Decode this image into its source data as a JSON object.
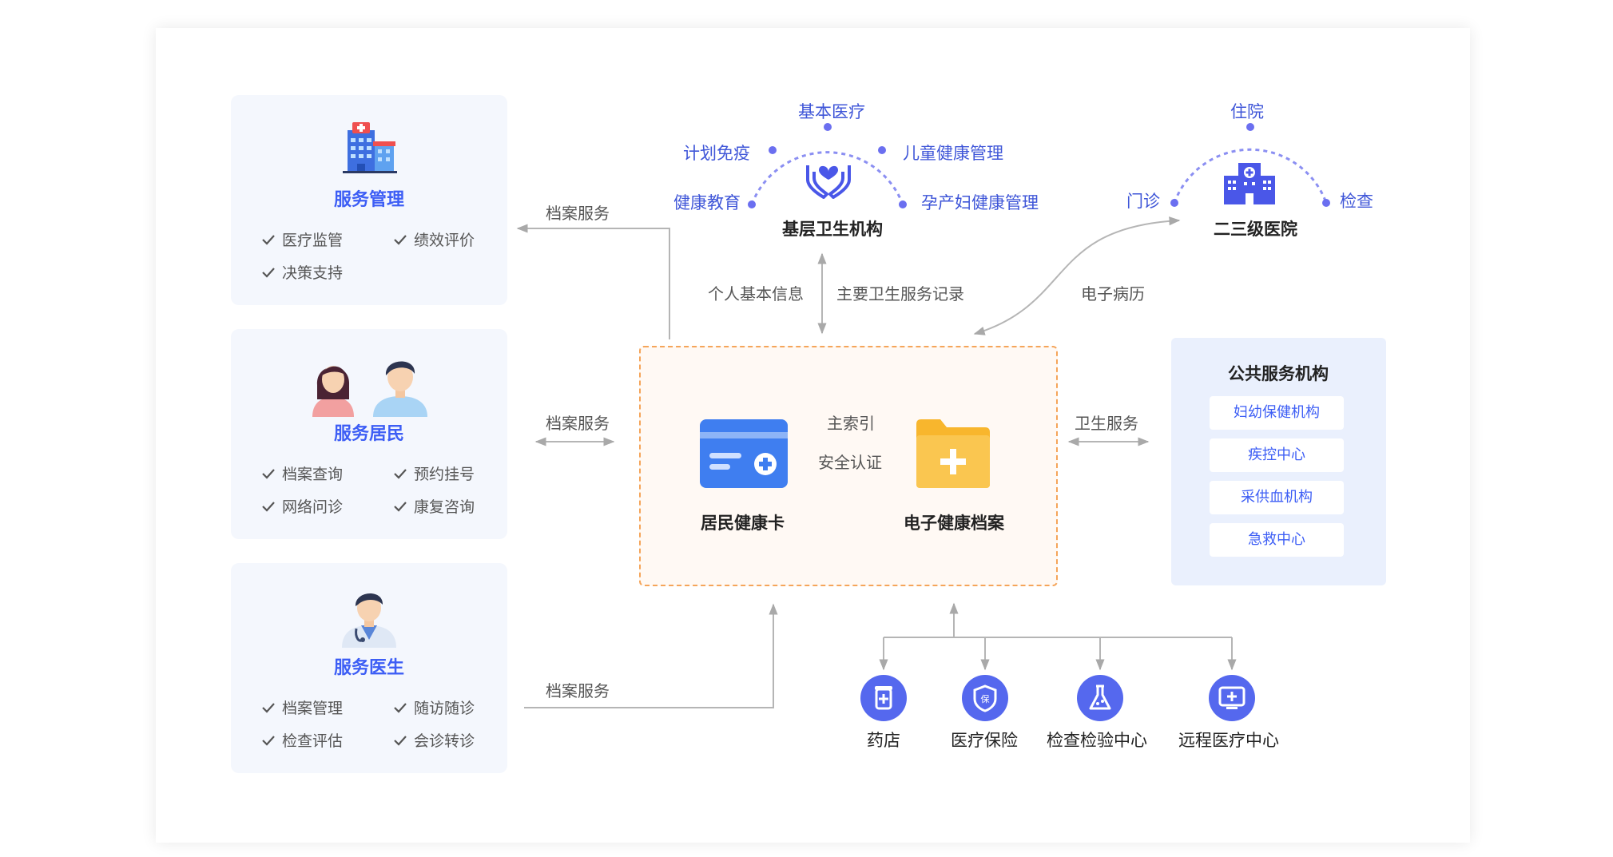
{
  "left_cards": [
    {
      "title": "服务管理",
      "features": [
        "医疗监管",
        "绩效评价",
        "决策支持"
      ]
    },
    {
      "title": "服务居民",
      "features": [
        "档案查询",
        "预约挂号",
        "网络问诊",
        "康复咨询"
      ]
    },
    {
      "title": "服务医生",
      "features": [
        "档案管理",
        "随访随诊",
        "检查评估",
        "会诊转诊"
      ]
    }
  ],
  "links": {
    "archive_service": "档案服务",
    "personal_info": "个人基本信息",
    "main_health_record": "主要卫生服务记录",
    "electronic_record": "电子病历",
    "health_service": "卫生服务",
    "master_index": "主索引",
    "security_auth": "安全认证"
  },
  "grassroots": {
    "label": "基层卫生机构",
    "services": [
      "基本医疗",
      "计划免疫",
      "儿童健康管理",
      "健康教育",
      "孕产妇健康管理"
    ]
  },
  "hospital": {
    "label": "二三级医院",
    "services": [
      "住院",
      "门诊",
      "检查"
    ]
  },
  "center": {
    "card_label": "居民健康卡",
    "folder_label": "电子健康档案"
  },
  "public_services": {
    "title": "公共服务机构",
    "items": [
      "妇幼保健机构",
      "疾控中心",
      "采供血机构",
      "急救中心"
    ]
  },
  "bottom_nodes": [
    {
      "label": "药店",
      "icon": "pharmacy-icon"
    },
    {
      "label": "医疗保险",
      "icon": "insurance-shield-icon"
    },
    {
      "label": "检查检验中心",
      "icon": "lab-flask-icon"
    },
    {
      "label": "远程医疗中心",
      "icon": "telemedicine-monitor-icon"
    }
  ],
  "colors": {
    "accent": "#3d5ef5",
    "arc": "#8b8ff2",
    "center_border": "#f5a55a",
    "center_bg": "#fff9f4",
    "card_bg": "#f4f7fd",
    "public_bg": "#eaf0fd",
    "folder": "#f8b62d",
    "health_card": "#3f7ef0",
    "node_circle": "#5568ee"
  }
}
